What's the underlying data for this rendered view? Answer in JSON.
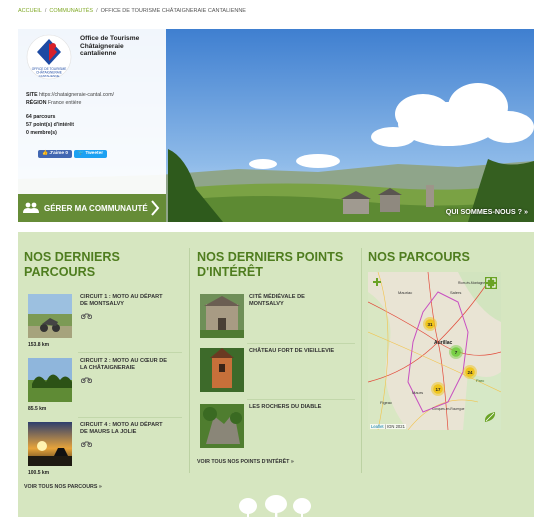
{
  "breadcrumb": {
    "items": [
      "ACCUEIL",
      "COMMUNAUTÉS",
      "OFFICE DE TOURISME CHÂTAIGNERAIE CANTALIENNE"
    ],
    "separator": "/"
  },
  "community": {
    "logo_text_line1": "OFFICE DE TOURISME",
    "logo_text_line2": "CHÂTAIGNERAIE",
    "logo_text_line3": "CANTALIENNE",
    "name_line1": "Office de Tourisme",
    "name_line2": "Châtaigneraie",
    "name_line3": "cantalienne",
    "site_label": "SITE",
    "site_value": "https://chataigneraie-cantal.com/",
    "region_label": "RÉGION",
    "region_value": "France entière",
    "stats": [
      "64 parcours",
      "57 point(s) d'intérêt",
      "0 membre(s)"
    ],
    "like_label": "J'aime 0",
    "tweet_label": "Tweeter",
    "manage_label": "GÉRER MA COMMUNAUTÉ",
    "who_label": "QUI SOMMES-NOUS ? »"
  },
  "routes": {
    "title_line1": "NOS DERNIERS",
    "title_line2": "PARCOURS",
    "items": [
      {
        "title_line1": "CIRCUIT 1 : MOTO AU DÉPART",
        "title_line2": "DE MONTSALVY",
        "distance": "153.8 km"
      },
      {
        "title_line1": "CIRCUIT 2 : MOTO AU CŒUR DE",
        "title_line2": "LA CHÂTAIGNERAIE",
        "distance": "85.5 km"
      },
      {
        "title_line1": "CIRCUIT 4 : MOTO AU DÉPART",
        "title_line2": "DE MAURS LA JOLIE",
        "distance": "100.5 km"
      }
    ],
    "see_all": "VOIR TOUS NOS PARCOURS »"
  },
  "pois": {
    "title_line1": "NOS DERNIERS POINTS",
    "title_line2": "D'INTÉRÊT",
    "items": [
      {
        "title_line1": "CITÉ MÉDIÉVALE DE",
        "title_line2": "MONTSALVY"
      },
      {
        "title_line1": "CHÂTEAU FORT DE VIEILLEVIE",
        "title_line2": ""
      },
      {
        "title_line1": "LES ROCHERS DU DIABLE",
        "title_line2": ""
      }
    ],
    "see_all": "VOIR TOUS NOS POINTS D'INTÉRÊT »"
  },
  "map_section": {
    "title": "NOS PARCOURS",
    "labels": [
      "Aurillac",
      "Salers",
      "Riom-ès-Montagnes",
      "Mauriac",
      "Maurs",
      "Figeac",
      "Conques-en-Rouergue",
      "Parc"
    ],
    "clusters": [
      "31",
      "7",
      "24",
      "17"
    ],
    "credit_leaflet": "Leaflet",
    "credit_ign": "IGN 2021"
  },
  "colors": {
    "accent_green": "#4f7d1f",
    "section_bg": "#d6e6c0",
    "link_green": "#7fa824",
    "facebook": "#4267b2",
    "twitter": "#1da1f2"
  }
}
